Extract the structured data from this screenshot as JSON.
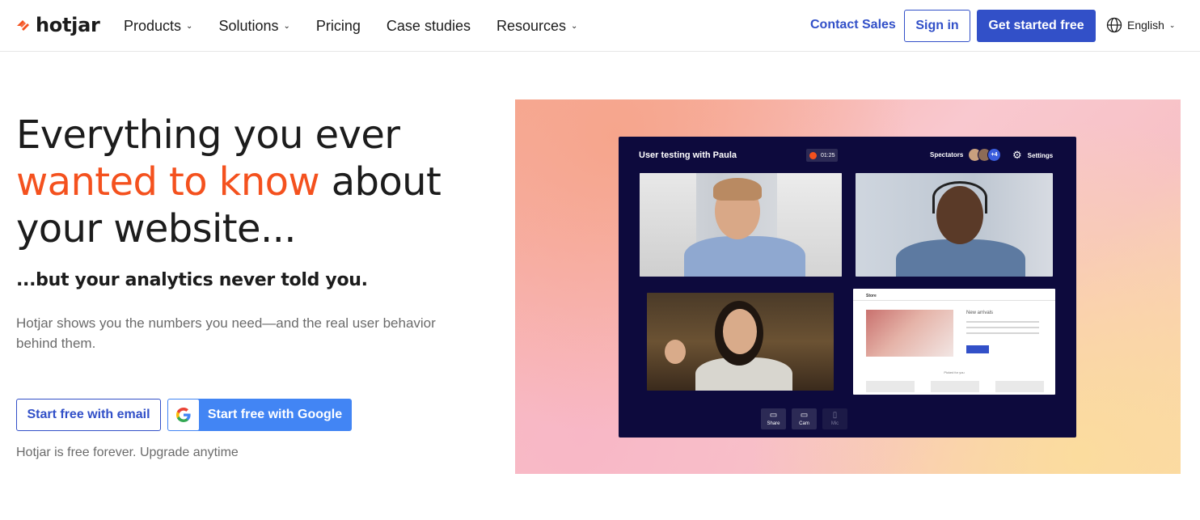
{
  "nav": {
    "logo_text": "hotjar",
    "links": [
      {
        "label": "Products",
        "has_dropdown": true
      },
      {
        "label": "Solutions",
        "has_dropdown": true
      },
      {
        "label": "Pricing",
        "has_dropdown": false
      },
      {
        "label": "Case studies",
        "has_dropdown": false
      },
      {
        "label": "Resources",
        "has_dropdown": true
      }
    ],
    "contact_sales": "Contact Sales",
    "sign_in": "Sign in",
    "get_started": "Get started free",
    "language": "English"
  },
  "hero": {
    "headline_part1": "Everything you ever",
    "headline_accent": "wanted to know",
    "headline_part2": " about",
    "headline_part3": "your website...",
    "subhead": "...but your analytics never told you.",
    "description": "Hotjar shows you the numbers you need—and the real user behavior behind them.",
    "btn_email": "Start free with email",
    "btn_google": "Start free with Google",
    "note": "Hotjar is free forever. Upgrade anytime"
  },
  "illustration": {
    "session_title": "User testing with Paula",
    "timer": "01:25",
    "spectators_label": "Spectators",
    "spectators_more": "+4",
    "settings_label": "Settings",
    "store_label": "Store",
    "new_arrivals": "New arrivals",
    "picked_for_you": "Picked for you",
    "controls": [
      {
        "label": "Share",
        "icon": "monitor-icon"
      },
      {
        "label": "Cam",
        "icon": "camera-icon"
      },
      {
        "label": "Mic",
        "icon": "mic-icon"
      }
    ]
  },
  "colors": {
    "accent_orange": "#f4511e",
    "brand_blue": "#3250c8",
    "google_blue": "#4285f4",
    "window_navy": "#0d0a3d"
  }
}
